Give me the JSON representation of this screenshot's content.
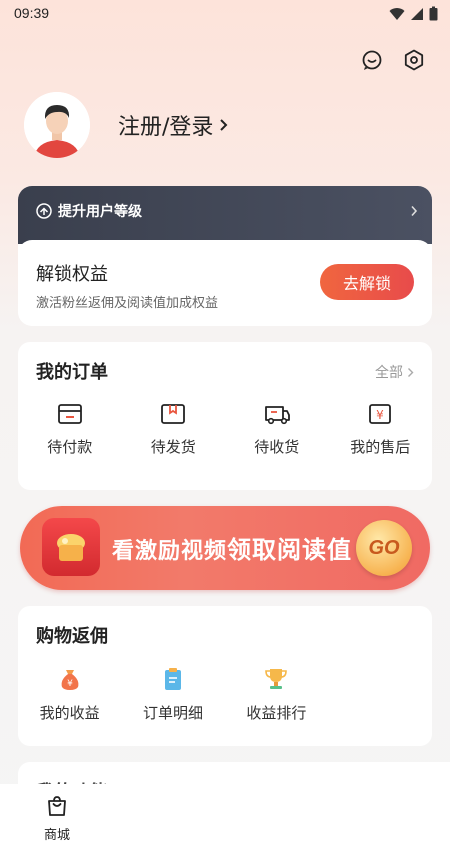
{
  "status_bar": {
    "time": "09:39"
  },
  "top_actions": {
    "icons": [
      "message-icon",
      "settings-icon"
    ]
  },
  "profile": {
    "login_label": "注册/登录"
  },
  "level_card": {
    "header_title": "提升用户等级",
    "unlock_title": "解锁权益",
    "unlock_subtitle": "激活粉丝返佣及阅读值加成权益",
    "unlock_button": "去解锁"
  },
  "orders": {
    "title": "我的订单",
    "all_link": "全部",
    "items": [
      {
        "label": "待付款",
        "icon": "wallet-icon"
      },
      {
        "label": "待发货",
        "icon": "package-icon"
      },
      {
        "label": "待收货",
        "icon": "truck-icon"
      },
      {
        "label": "我的售后",
        "icon": "refund-icon"
      }
    ]
  },
  "banner": {
    "text_main": "看激励视频",
    "text_highlight": "领取阅读值",
    "button": "GO"
  },
  "rebate": {
    "title": "购物返佣",
    "items": [
      {
        "label": "我的收益",
        "icon": "money-bag-icon"
      },
      {
        "label": "订单明细",
        "icon": "clipboard-icon"
      },
      {
        "label": "收益排行",
        "icon": "trophy-icon"
      }
    ]
  },
  "more": {
    "title": "我的功能"
  },
  "tabbar": {
    "items": [
      {
        "label": "商城",
        "icon": "shopping-bag-icon"
      }
    ]
  },
  "colors": {
    "accent": "#ec5a45",
    "dark_header": "#3f4454"
  }
}
